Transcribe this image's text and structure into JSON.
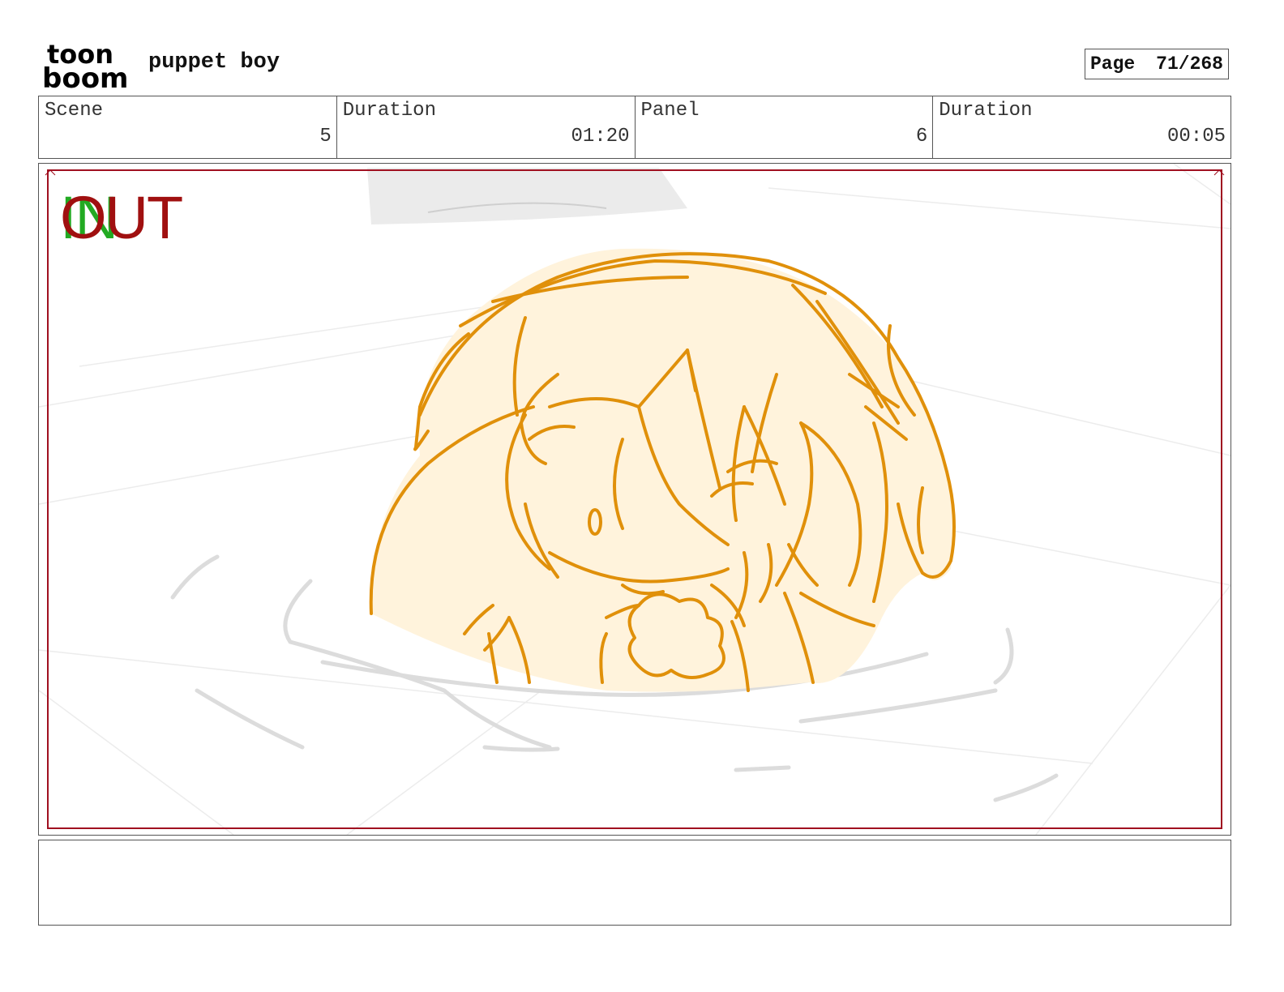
{
  "header": {
    "logo_lines": [
      "toon",
      "boom"
    ],
    "project_title": "puppet boy",
    "page_label": "Page",
    "page_value": "71/268"
  },
  "info": [
    {
      "label": "Scene",
      "value": "5"
    },
    {
      "label": "Duration",
      "value": "01:20"
    },
    {
      "label": "Panel",
      "value": "6"
    },
    {
      "label": "Duration",
      "value": "00:05"
    }
  ],
  "panel": {
    "in_marker": "IN",
    "out_marker": "OUT"
  },
  "colors": {
    "sketch_orange": "#e0900a",
    "skin_fill": "#fff3dc",
    "safe_frame": "#a01020",
    "in_green": "#22aa22",
    "out_red": "#a01010"
  },
  "notes": {
    "text": ""
  }
}
